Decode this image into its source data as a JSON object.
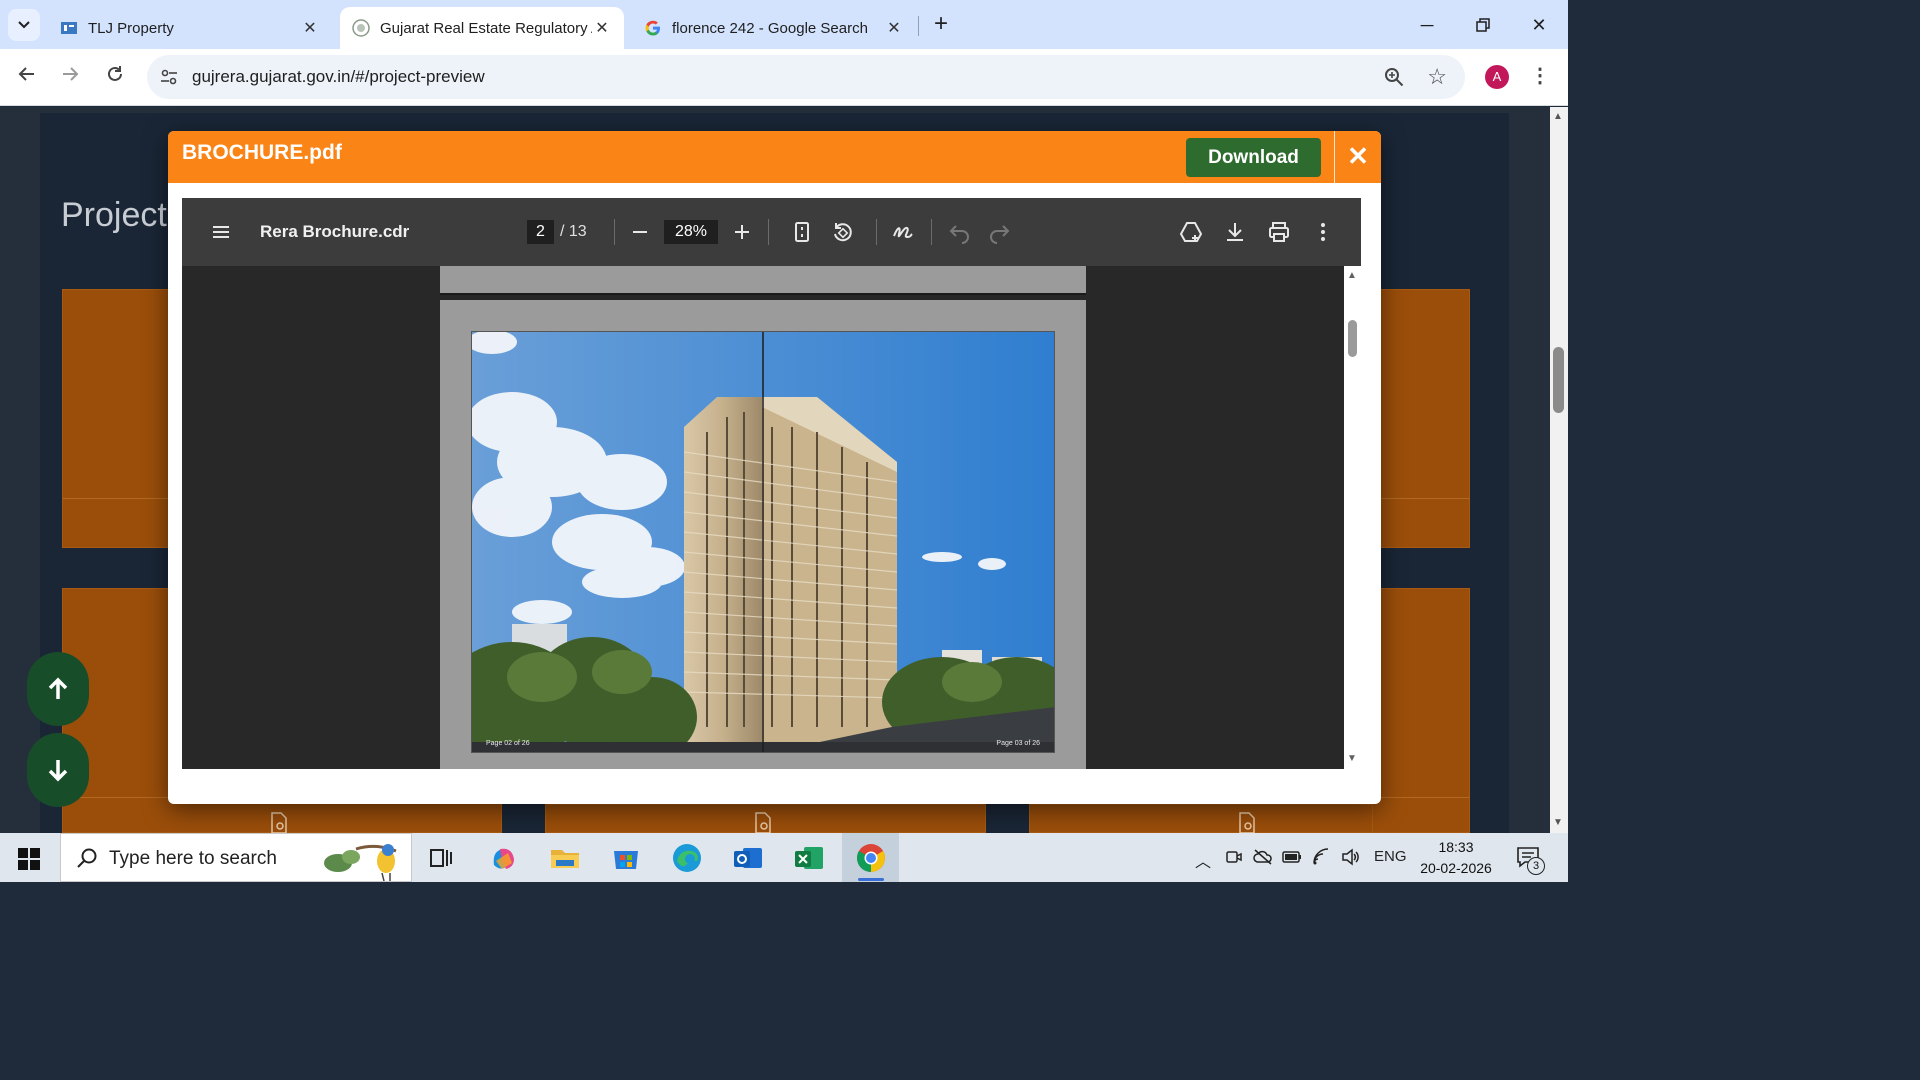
{
  "browser": {
    "tabs": [
      {
        "label": "TLJ Property",
        "icon": "tlj-favicon",
        "active": false
      },
      {
        "label": "Gujarat Real Estate Regulatory A",
        "icon": "gujrera-favicon",
        "active": true
      },
      {
        "label": "florence 242 - Google Search",
        "icon": "google-favicon",
        "active": false
      }
    ],
    "url": "gujrera.gujarat.gov.in/#/project-preview",
    "profile_initial": "A"
  },
  "page": {
    "title": "Project"
  },
  "modal": {
    "title": "BROCHURE.pdf",
    "download_label": "Download",
    "close_label": "✕"
  },
  "viewer": {
    "doc_title": "Rera Brochure.cdr",
    "current_page": "2",
    "total_pages": "/ 13",
    "zoom": "28%",
    "page_left_label": "Page 02 of 26",
    "page_right_label": "Page 03 of 26"
  },
  "taskbar": {
    "search_placeholder": "Type here to search",
    "language": "ENG",
    "time": "18:33",
    "date": "20-02-2026",
    "notification_count": "3"
  },
  "colors": {
    "accent_orange": "#fb8416",
    "download_green": "#2e6b2e",
    "viewer_bg": "#282828"
  }
}
